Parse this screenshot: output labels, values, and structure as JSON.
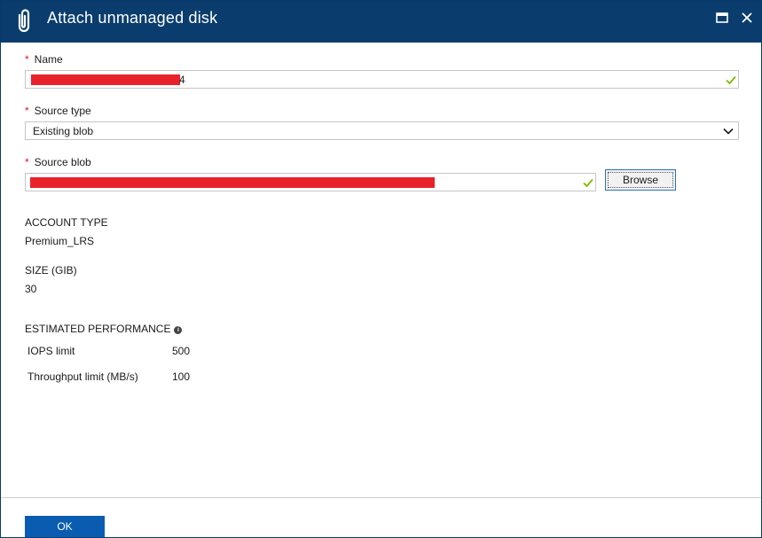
{
  "window": {
    "title": "Attach unmanaged disk",
    "app_icon": "paperclip-icon",
    "maximize_icon": "maximize-icon",
    "close_icon": "close-icon"
  },
  "form": {
    "required_marker": "*",
    "name": {
      "label": "Name",
      "value_visible_suffix": "4",
      "redacted": true,
      "valid": true
    },
    "source_type": {
      "label": "Source type",
      "value": "Existing blob",
      "icon": "chevron-down-icon"
    },
    "source_blob": {
      "label": "Source blob",
      "redacted": true,
      "valid": true,
      "browse_label": "Browse"
    }
  },
  "details": {
    "account_type": {
      "label": "ACCOUNT TYPE",
      "value": "Premium_LRS"
    },
    "size": {
      "label": "SIZE (GIB)",
      "value": "30"
    },
    "performance": {
      "label": "ESTIMATED PERFORMANCE",
      "icon": "info-icon",
      "rows": [
        {
          "name": "IOPS limit",
          "value": "500"
        },
        {
          "name": "Throughput limit (MB/s)",
          "value": "100"
        }
      ]
    }
  },
  "footer": {
    "ok_label": "OK"
  },
  "colors": {
    "titlebar": "#0a3d6e",
    "required": "#e81123",
    "valid_check": "#7fba00",
    "primary_button": "#0a5cb0",
    "redaction": "#e8222b"
  }
}
